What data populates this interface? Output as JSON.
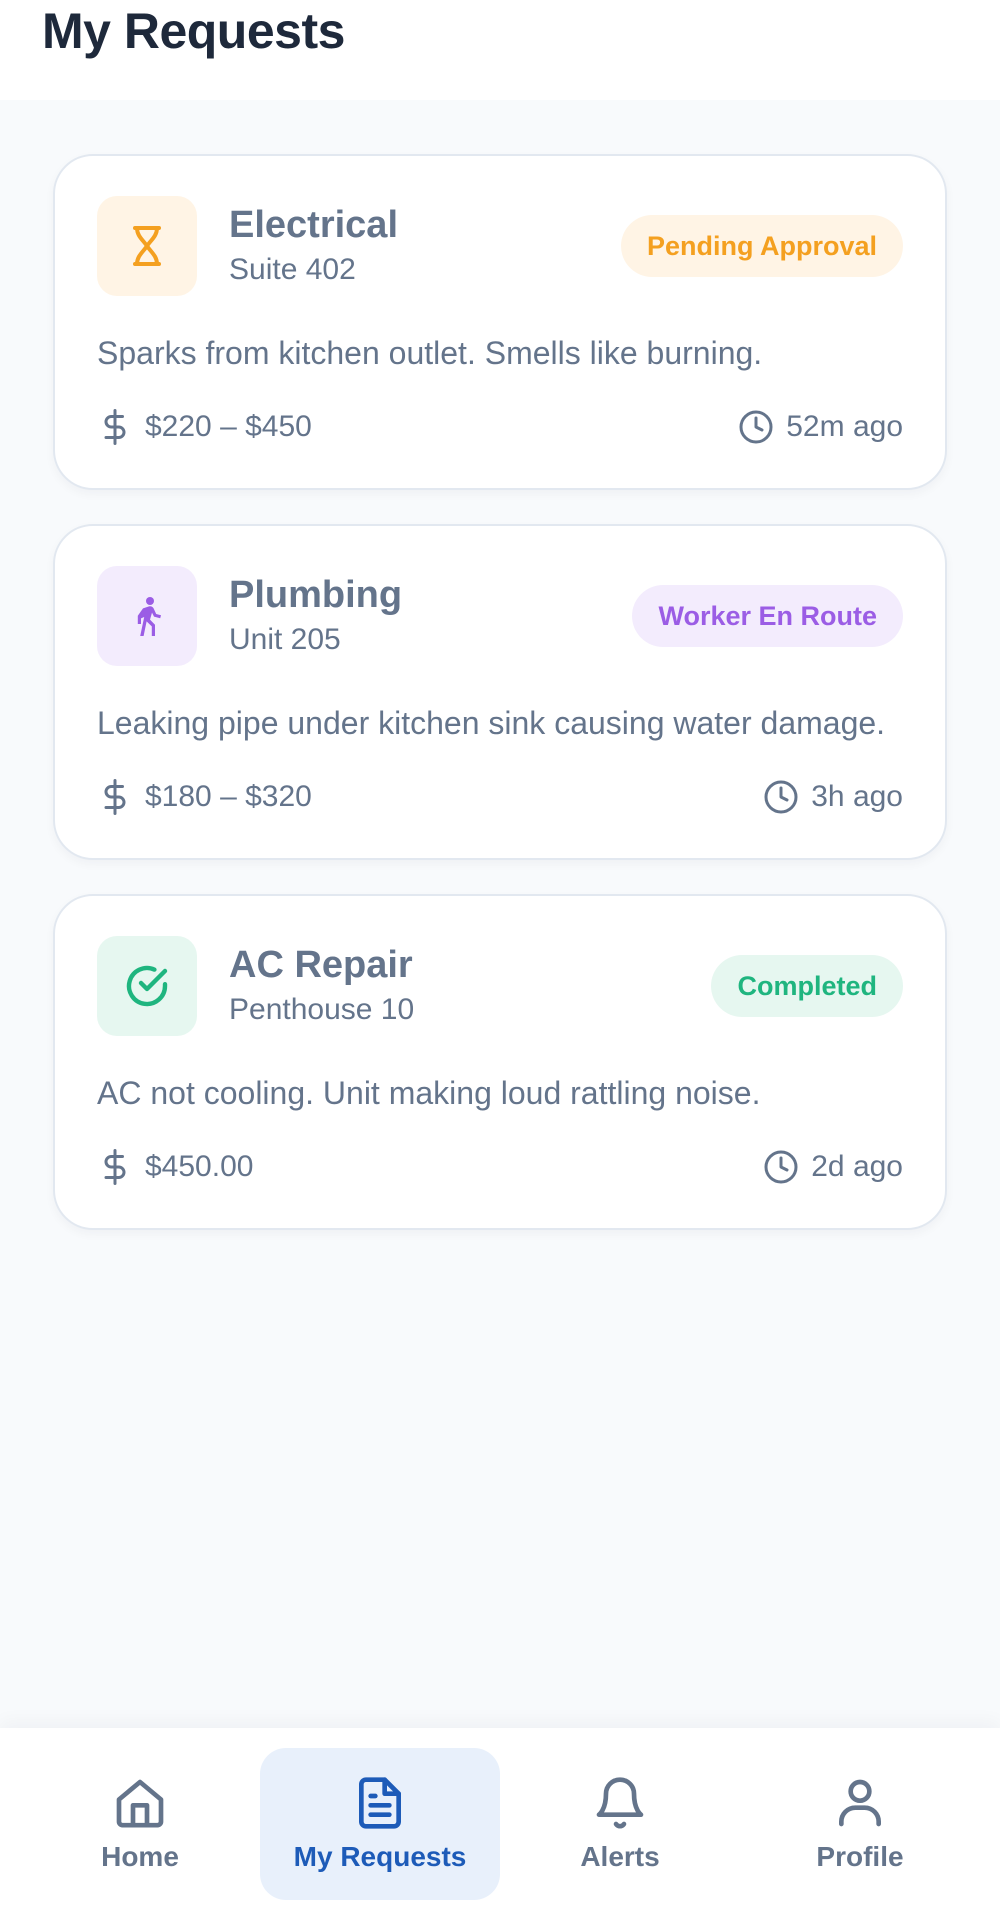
{
  "header": {
    "title": "My Requests"
  },
  "requests": [
    {
      "title": "Electrical",
      "location": "Suite 402",
      "status": "Pending Approval",
      "description": "Sparks from kitchen outlet. Smells like burning.",
      "price": "$220 – $450",
      "time": "52m ago",
      "icon": "hourglass-icon",
      "accent": "#f4a020",
      "accent_bg": "#fff4e5"
    },
    {
      "title": "Plumbing",
      "location": "Unit 205",
      "status": "Worker En Route",
      "description": "Leaking pipe under kitchen sink causing water damage.",
      "price": "$180 – $320",
      "time": "3h ago",
      "icon": "running-person-icon",
      "accent": "#9b5de5",
      "accent_bg": "#f3ecfd"
    },
    {
      "title": "AC Repair",
      "location": "Penthouse 10",
      "status": "Completed",
      "description": "AC not cooling. Unit making loud rattling noise.",
      "price": "$450.00",
      "time": "2d ago",
      "icon": "check-circle-icon",
      "accent": "#1fb57f",
      "accent_bg": "#e6f7f0"
    }
  ],
  "nav": {
    "items": [
      {
        "label": "Home",
        "icon": "home-icon",
        "active": false
      },
      {
        "label": "My Requests",
        "icon": "document-icon",
        "active": true
      },
      {
        "label": "Alerts",
        "icon": "bell-icon",
        "active": false
      },
      {
        "label": "Profile",
        "icon": "user-icon",
        "active": false
      }
    ]
  },
  "colors": {
    "title": "#1e293b",
    "text": "#64748b",
    "nav_active": "#1d5bb8",
    "nav_active_bg": "#e8f0fb"
  }
}
